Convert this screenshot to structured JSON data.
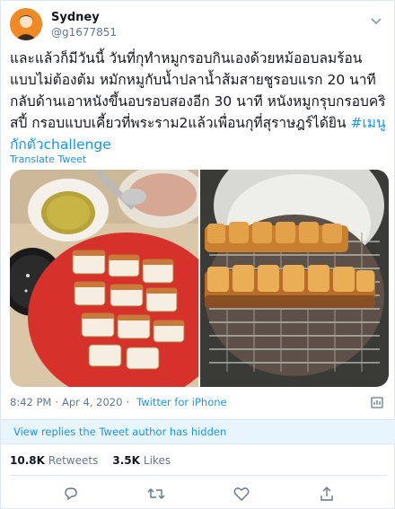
{
  "user": {
    "display_name": "Sydney",
    "handle": "@g1677851"
  },
  "tweet": {
    "text": "และแล้วก็มีวันนี้ วันที่กุทำหมูกรอบกินเองด้วยหม้ออบลมร้อน แบบไม่ต้องต้ม หมักหมูกับน้ำปลาน้ำส้มสายชูรอบแรก 20 นาที กลับด้านเอาหนังขึ้นอบรอบสองอีก 30 นาที หนังหมูกรุบกรอบคริสปี้ กรอบแบบเคี้ยวที่พระราม2แล้วเพื่อนกุที่สุราษฎร์ได้ยิน ",
    "hashtag": "#เมนูกักตัวchallenge",
    "translate_label": "Translate Tweet"
  },
  "meta": {
    "time": "8:42 PM",
    "separator": "·",
    "date": "Apr 4, 2020",
    "source": "Twitter for iPhone"
  },
  "hidden_replies_label": "View replies the Tweet author has hidden",
  "stats": {
    "retweets_count": "10.8K",
    "retweets_label": "Retweets",
    "likes_count": "3.5K",
    "likes_label": "Likes"
  },
  "colors": {
    "accent": "#1b95e0",
    "text": "#14171a",
    "muted": "#657786",
    "hidden_bar_bg": "#e8f5fd"
  },
  "icons": [
    "caret-down-icon",
    "analytics-icon",
    "reply-icon",
    "retweet-icon",
    "like-icon",
    "share-icon"
  ]
}
